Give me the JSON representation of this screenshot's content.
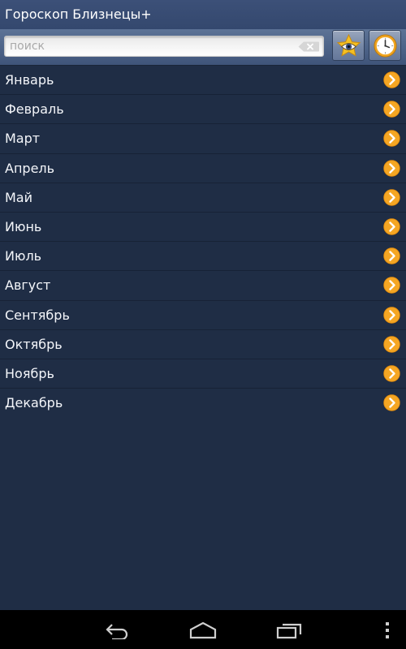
{
  "app": {
    "title": "Гороскоп Близнецы+"
  },
  "search": {
    "placeholder": "поиск",
    "clear_icon": "backspace-icon"
  },
  "toolbar": {
    "favorites_icon": "star-eye-icon",
    "history_icon": "clock-icon"
  },
  "months": [
    {
      "label": "Январь"
    },
    {
      "label": "Февраль"
    },
    {
      "label": "Март"
    },
    {
      "label": "Апрель"
    },
    {
      "label": "Май"
    },
    {
      "label": "Июнь"
    },
    {
      "label": "Июль"
    },
    {
      "label": "Август"
    },
    {
      "label": "Сентябрь"
    },
    {
      "label": "Октябрь"
    },
    {
      "label": "Ноябрь"
    },
    {
      "label": "Декабрь"
    }
  ],
  "row_icon": "chevron-right-icon",
  "colors": {
    "background": "#1f2d45",
    "title_bar": "#3c5078",
    "accent_orange": "#f5a623",
    "navbar": "#000000"
  },
  "navbar": {
    "icons": [
      "back-icon",
      "home-icon",
      "recent-apps-icon",
      "menu-icon"
    ]
  }
}
